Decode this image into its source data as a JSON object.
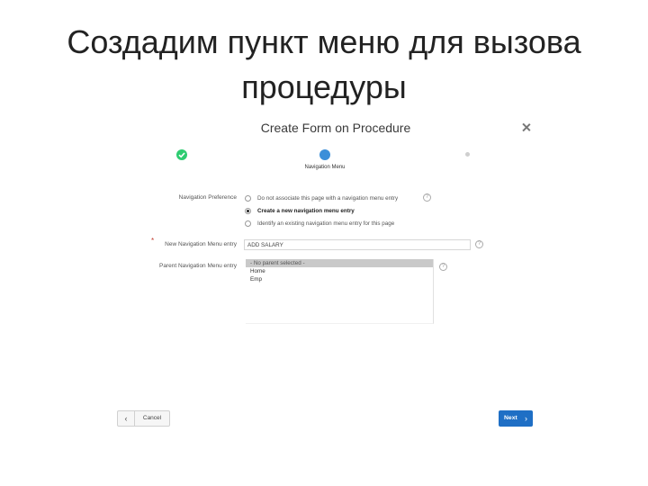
{
  "slide": {
    "title_line1": "Создадим пункт меню для вызова",
    "title_line2": "процедуры"
  },
  "dialog": {
    "title": "Create Form on Procedure",
    "close_icon": "close-icon",
    "steps": {
      "current_label": "Navigation Menu"
    },
    "navigation_preference": {
      "label": "Navigation Preference",
      "options": [
        {
          "label": "Do not associate this page with a navigation menu entry",
          "checked": false
        },
        {
          "label": "Create a new navigation menu entry",
          "checked": true
        },
        {
          "label": "Identify an existing navigation menu entry for this page",
          "checked": false
        }
      ]
    },
    "new_menu_entry": {
      "label": "New Navigation Menu entry",
      "value": "ADD SALARY"
    },
    "parent_menu_entry": {
      "label": "Parent Navigation Menu entry",
      "options": [
        "- No parent selected -",
        "Home",
        "Emp"
      ],
      "selected_index": 0
    },
    "buttons": {
      "back": "‹",
      "cancel": "Cancel",
      "next": "Next",
      "next_chevron": "›"
    },
    "colors": {
      "accent": "#1f6fc5",
      "step_done": "#2ecc71",
      "step_current": "#3b8fd9"
    }
  }
}
